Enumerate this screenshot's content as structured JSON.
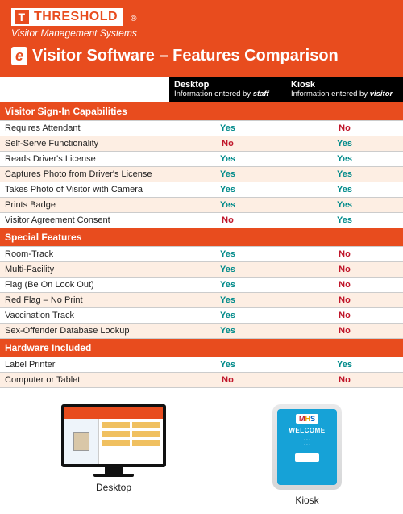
{
  "header": {
    "logo_letter": "T",
    "logo_text": "THRESHOLD",
    "registered": "®",
    "tagline": "Visitor Management Systems",
    "e_prefix": "e",
    "title": "Visitor Software – Features Comparison"
  },
  "columns": {
    "feature": "",
    "desktop": {
      "label": "Desktop",
      "sub_prefix": "Information entered by ",
      "sub_em": "staff"
    },
    "kiosk": {
      "label": "Kiosk",
      "sub_prefix": "Information entered by ",
      "sub_em": "visitor"
    }
  },
  "values": {
    "yes": "Yes",
    "no": "No"
  },
  "sections": [
    {
      "title": "Visitor Sign-In Capabilities",
      "rows": [
        {
          "feature": "Requires Attendant",
          "desktop": "yes",
          "kiosk": "no"
        },
        {
          "feature": "Self-Serve Functionality",
          "desktop": "no",
          "kiosk": "yes"
        },
        {
          "feature": "Reads Driver's License",
          "desktop": "yes",
          "kiosk": "yes"
        },
        {
          "feature": "Captures Photo from Driver's License",
          "desktop": "yes",
          "kiosk": "yes"
        },
        {
          "feature": "Takes Photo of Visitor with Camera",
          "desktop": "yes",
          "kiosk": "yes"
        },
        {
          "feature": "Prints Badge",
          "desktop": "yes",
          "kiosk": "yes"
        },
        {
          "feature": "Visitor Agreement Consent",
          "desktop": "no",
          "kiosk": "yes"
        }
      ]
    },
    {
      "title": "Special Features",
      "rows": [
        {
          "feature": "Room-Track",
          "desktop": "yes",
          "kiosk": "no"
        },
        {
          "feature": "Multi-Facility",
          "desktop": "yes",
          "kiosk": "no"
        },
        {
          "feature": "Flag (Be On Look Out)",
          "desktop": "yes",
          "kiosk": "no"
        },
        {
          "feature": "Red Flag – No Print",
          "desktop": "yes",
          "kiosk": "no"
        },
        {
          "feature": "Vaccination Track",
          "desktop": "yes",
          "kiosk": "no"
        },
        {
          "feature": "Sex-Offender Database Lookup",
          "desktop": "yes",
          "kiosk": "no"
        }
      ]
    },
    {
      "title": "Hardware Included",
      "rows": [
        {
          "feature": "Label Printer",
          "desktop": "yes",
          "kiosk": "yes"
        },
        {
          "feature": "Computer or Tablet",
          "desktop": "no",
          "kiosk": "no"
        }
      ]
    }
  ],
  "products": {
    "desktop_label": "Desktop",
    "kiosk_label": "Kiosk",
    "kiosk_screen": {
      "logo_m": "M",
      "logo_h": "H",
      "logo_s": "S",
      "welcome": "WELCOME"
    }
  }
}
